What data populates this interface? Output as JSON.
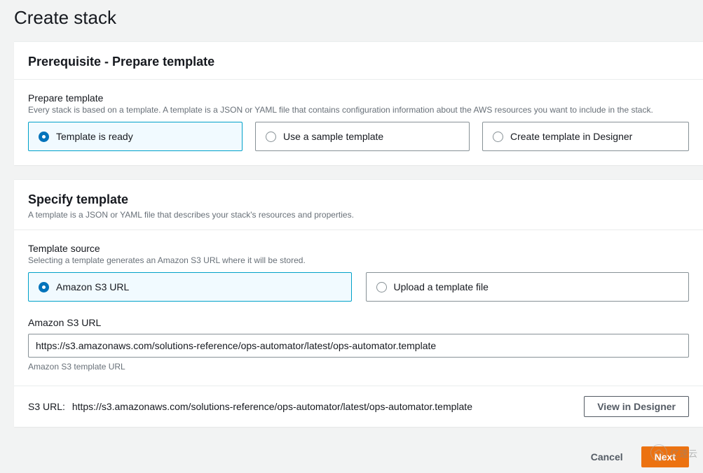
{
  "pageTitle": "Create stack",
  "prereq": {
    "heading": "Prerequisite - Prepare template",
    "fieldLabel": "Prepare template",
    "fieldDesc": "Every stack is based on a template. A template is a JSON or YAML file that contains configuration information about the AWS resources you want to include in the stack.",
    "options": {
      "ready": "Template is ready",
      "sample": "Use a sample template",
      "designer": "Create template in Designer"
    }
  },
  "specify": {
    "heading": "Specify template",
    "headDesc": "A template is a JSON or YAML file that describes your stack's resources and properties.",
    "sourceLabel": "Template source",
    "sourceDesc": "Selecting a template generates an Amazon S3 URL where it will be stored.",
    "sourceOptions": {
      "s3": "Amazon S3 URL",
      "upload": "Upload a template file"
    },
    "urlLabel": "Amazon S3 URL",
    "urlValue": "https://s3.amazonaws.com/solutions-reference/ops-automator/latest/ops-automator.template",
    "urlHint": "Amazon S3 template URL",
    "footerLabel": "S3 URL:",
    "footerUrl": "https://s3.amazonaws.com/solutions-reference/ops-automator/latest/ops-automator.template",
    "viewDesigner": "View in Designer"
  },
  "actions": {
    "cancel": "Cancel",
    "next": "Next"
  },
  "watermark": "亿速云"
}
